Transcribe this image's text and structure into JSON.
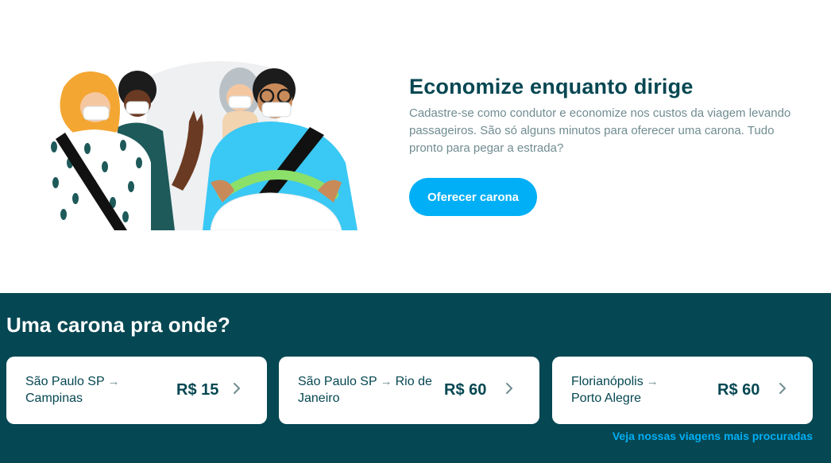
{
  "hero": {
    "title": "Economize enquanto dirige",
    "description": "Cadastre-se como condutor e economize nos custos da viagem levando passageiros. São só alguns minutos para oferecer uma carona. Tudo pronto para pegar a estrada?",
    "cta_label": "Oferecer carona"
  },
  "destinations": {
    "title": "Uma carona pra onde?",
    "cards": [
      {
        "from": "São Paulo SP",
        "to": "Campinas",
        "price": "R$ 15"
      },
      {
        "from": "São Paulo SP",
        "to": "Rio de Janeiro",
        "price": "R$ 60"
      },
      {
        "from": "Florianópolis",
        "to": "Porto Alegre",
        "price": "R$ 60"
      }
    ],
    "arrow_glyph": "→",
    "more_link": "Veja nossas viagens mais procuradas"
  },
  "colors": {
    "brand_dark": "#054752",
    "brand_blue": "#00aff5",
    "muted_text": "#708c91"
  },
  "icons": [
    "illustration-people-car",
    "arrow-right-icon",
    "chevron-right-icon"
  ]
}
